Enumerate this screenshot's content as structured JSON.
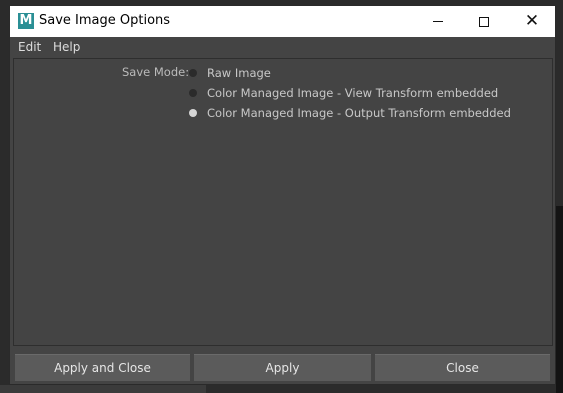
{
  "window": {
    "title": "Save Image Options",
    "app_icon_letter": "M"
  },
  "menu": {
    "items": [
      "Edit",
      "Help"
    ]
  },
  "save_mode": {
    "label": "Save Mode:",
    "options": [
      {
        "label": "Raw Image",
        "selected": false
      },
      {
        "label": "Color Managed Image - View Transform embedded",
        "selected": false
      },
      {
        "label": "Color Managed Image - Output Transform embedded",
        "selected": true
      }
    ]
  },
  "buttons": {
    "apply_and_close": "Apply and Close",
    "apply": "Apply",
    "close": "Close"
  },
  "colors": {
    "panel": "#444444",
    "button": "#5b5b5b",
    "icon_accent": "#2a8f95"
  }
}
